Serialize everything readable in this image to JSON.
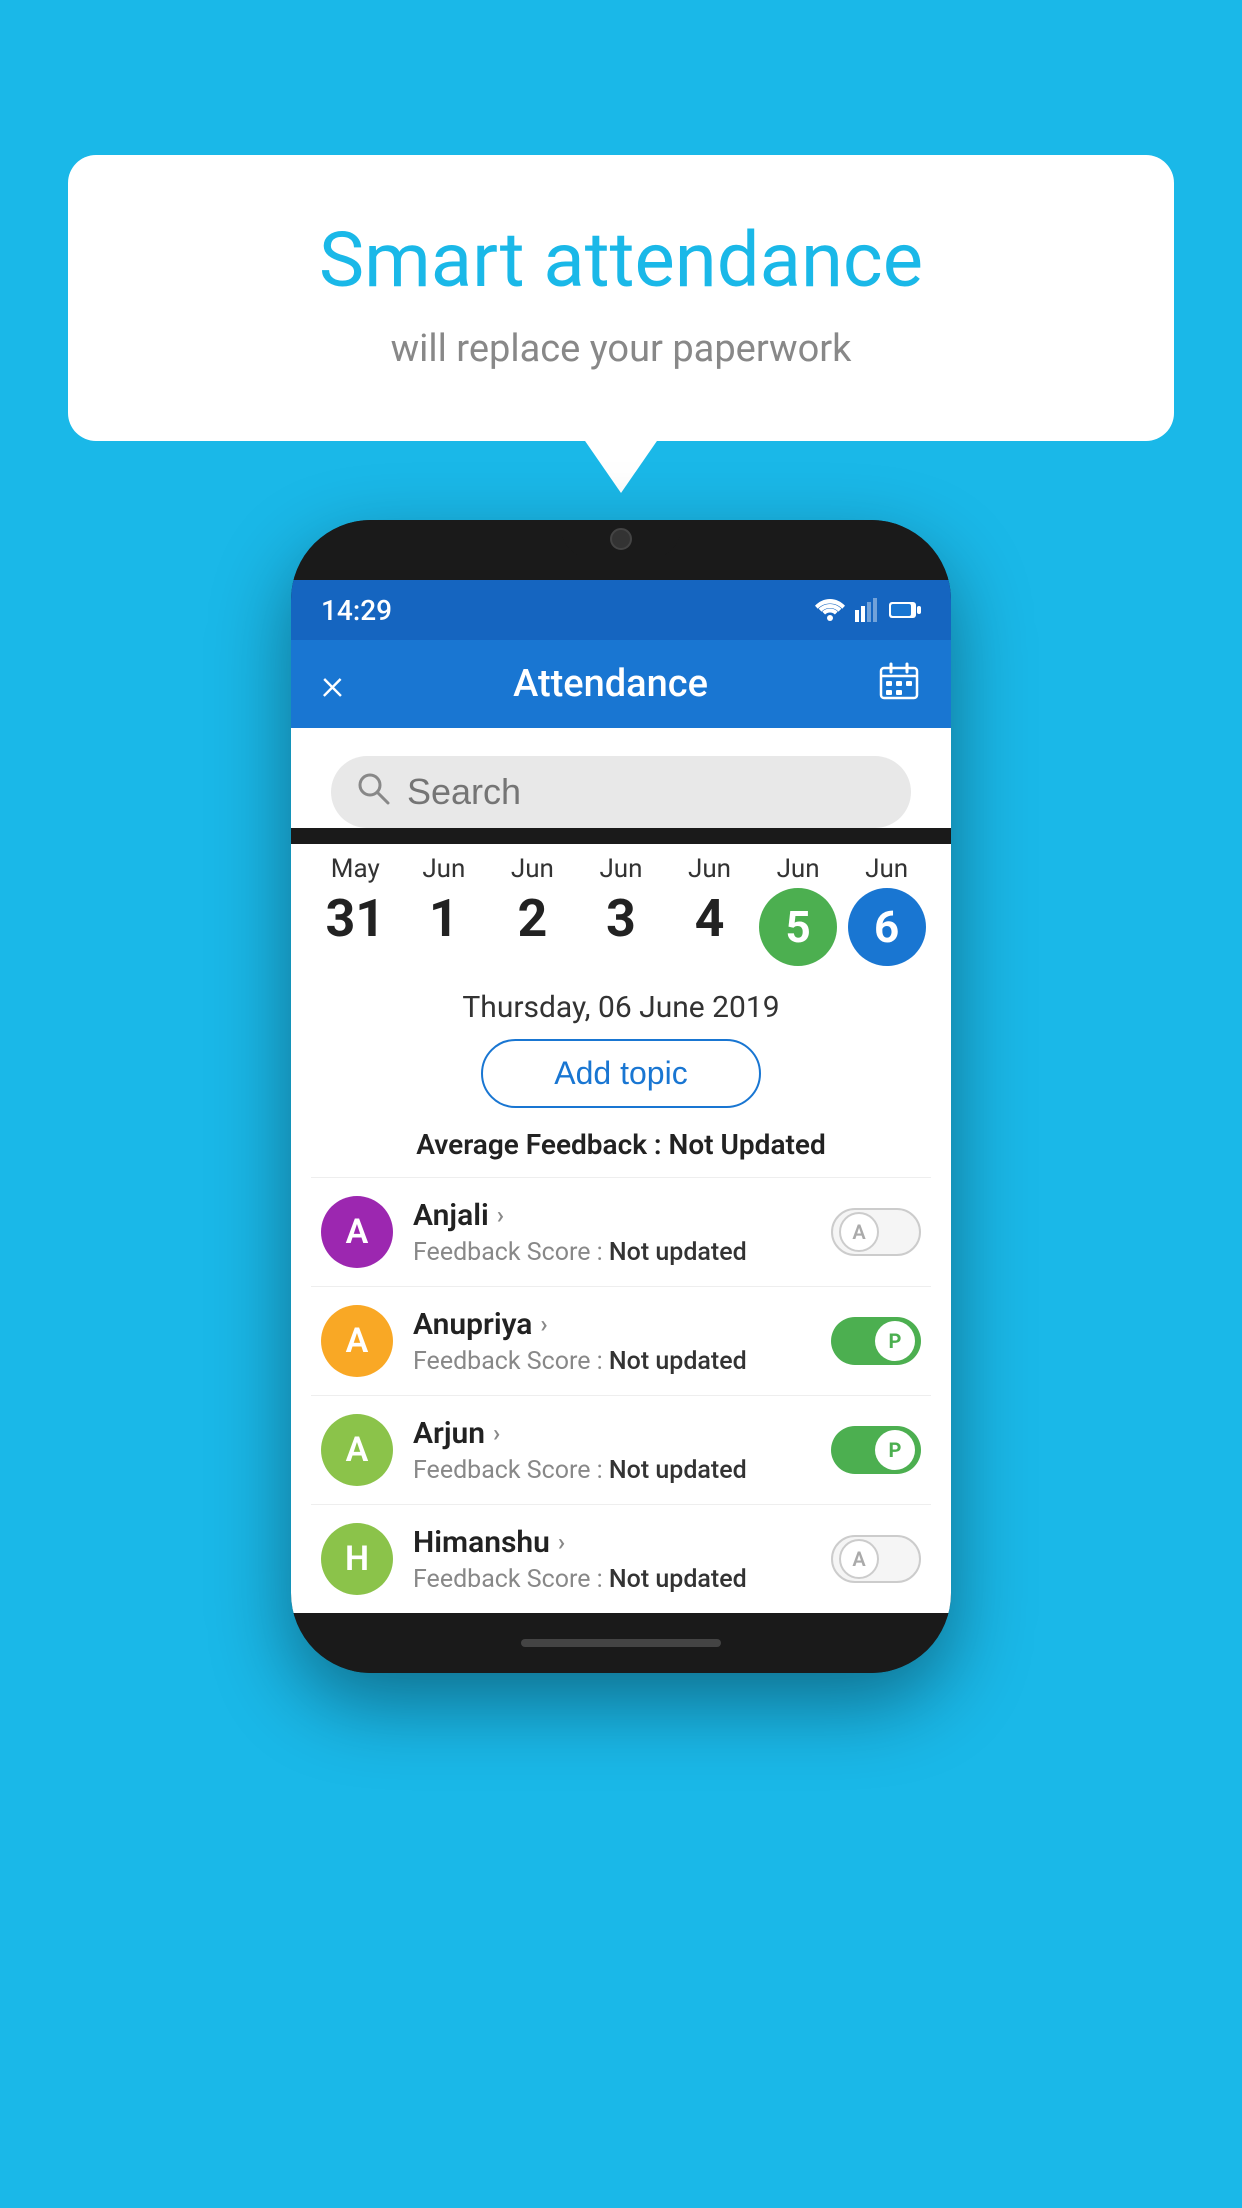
{
  "background_color": "#1ab8e8",
  "speech_bubble": {
    "title": "Smart attendance",
    "subtitle": "will replace your paperwork"
  },
  "phone": {
    "status_bar": {
      "time": "14:29"
    },
    "app_bar": {
      "title": "Attendance",
      "close_label": "×"
    },
    "search": {
      "placeholder": "Search"
    },
    "calendar": {
      "dates": [
        {
          "month": "May",
          "day": "31",
          "style": "normal"
        },
        {
          "month": "Jun",
          "day": "1",
          "style": "normal"
        },
        {
          "month": "Jun",
          "day": "2",
          "style": "normal"
        },
        {
          "month": "Jun",
          "day": "3",
          "style": "normal"
        },
        {
          "month": "Jun",
          "day": "4",
          "style": "normal"
        },
        {
          "month": "Jun",
          "day": "5",
          "style": "green"
        },
        {
          "month": "Jun",
          "day": "6",
          "style": "blue"
        }
      ],
      "selected_date_text": "Thursday, 06 June 2019"
    },
    "add_topic_label": "Add topic",
    "average_feedback": {
      "label": "Average Feedback :",
      "value": "Not Updated"
    },
    "students": [
      {
        "name": "Anjali",
        "initial": "A",
        "avatar_color": "#9c27b0",
        "feedback_label": "Feedback Score :",
        "feedback_value": "Not updated",
        "toggle": "off",
        "toggle_letter": "A"
      },
      {
        "name": "Anupriya",
        "initial": "A",
        "avatar_color": "#f9a825",
        "feedback_label": "Feedback Score :",
        "feedback_value": "Not updated",
        "toggle": "on",
        "toggle_letter": "P"
      },
      {
        "name": "Arjun",
        "initial": "A",
        "avatar_color": "#8bc34a",
        "feedback_label": "Feedback Score :",
        "feedback_value": "Not updated",
        "toggle": "on",
        "toggle_letter": "P"
      },
      {
        "name": "Himanshu",
        "initial": "H",
        "avatar_color": "#8bc34a",
        "feedback_label": "Feedback Score :",
        "feedback_value": "Not updated",
        "toggle": "off",
        "toggle_letter": "A"
      }
    ]
  }
}
